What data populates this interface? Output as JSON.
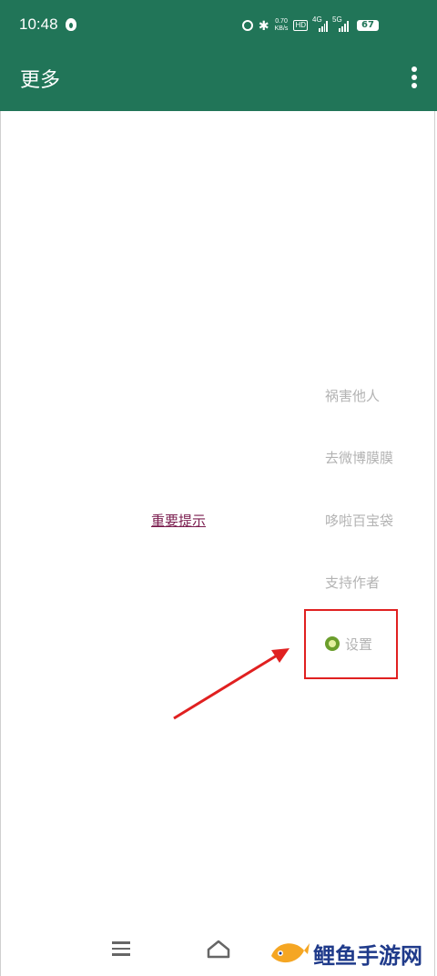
{
  "status_bar": {
    "time": "10:48",
    "speed_value": "0.70",
    "speed_unit": "KB/s",
    "hd_label": "HD",
    "net1": "4G",
    "net2": "5G",
    "battery": "67"
  },
  "appbar": {
    "title": "更多",
    "overflow_icon": "more-vert-icon"
  },
  "menu": {
    "items": [
      {
        "label": "祸害他人"
      },
      {
        "label": "去微博膜膜"
      },
      {
        "label": "哆啦百宝袋"
      },
      {
        "label": "支持作者"
      },
      {
        "label": "设置",
        "icon": "settings-icon"
      }
    ]
  },
  "notice_link": "重要提示",
  "annotation": {
    "color": "#e02020"
  },
  "watermark": {
    "text": "鲤鱼手游网"
  },
  "colors": {
    "appbar": "#217558",
    "menu_text": "#b3b3b3",
    "link": "#7a1c4e"
  }
}
